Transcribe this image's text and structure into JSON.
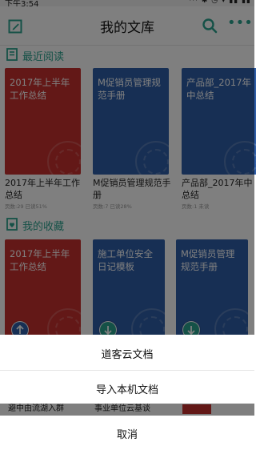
{
  "status": {
    "time": "下午3:54",
    "icons": "··· ✱ ◷ ▾ ▮▮ ▮▮"
  },
  "appbar": {
    "title": "我的文库"
  },
  "recent": {
    "title": "最近阅读",
    "items": [
      {
        "cover_title": "2017年上半年工作总结",
        "caption": "2017年上半年工作总结",
        "meta": "页数:29 已读51%",
        "color": "red"
      },
      {
        "cover_title": "M促销员管理规范手册",
        "caption": "M促销员管理规范手册",
        "meta": "页数:7 已读28%",
        "color": "blue"
      },
      {
        "cover_title": "产品部_2017年中总结",
        "caption": "产品部_2017年中总结",
        "meta": "页数:1 未读",
        "color": "blue"
      }
    ]
  },
  "favorites": {
    "title": "我的收藏",
    "items": [
      {
        "cover_title": "2017年上半年工作总结",
        "color": "red",
        "badge": "upload"
      },
      {
        "cover_title": "施工单位安全日记模板",
        "color": "blue",
        "badge": "download"
      },
      {
        "cover_title": "M促销员管理规范手册",
        "color": "blue",
        "badge": "download"
      }
    ],
    "peek_captions": [
      "避中由流湖入群",
      "事业单位云基谈"
    ]
  },
  "action_sheet": {
    "option1": "道客云文档",
    "option2": "导入本机文档",
    "cancel": "取消"
  },
  "colors": {
    "accent": "#2aa38f",
    "red": "#c7302e",
    "blue": "#2f5ea8"
  }
}
